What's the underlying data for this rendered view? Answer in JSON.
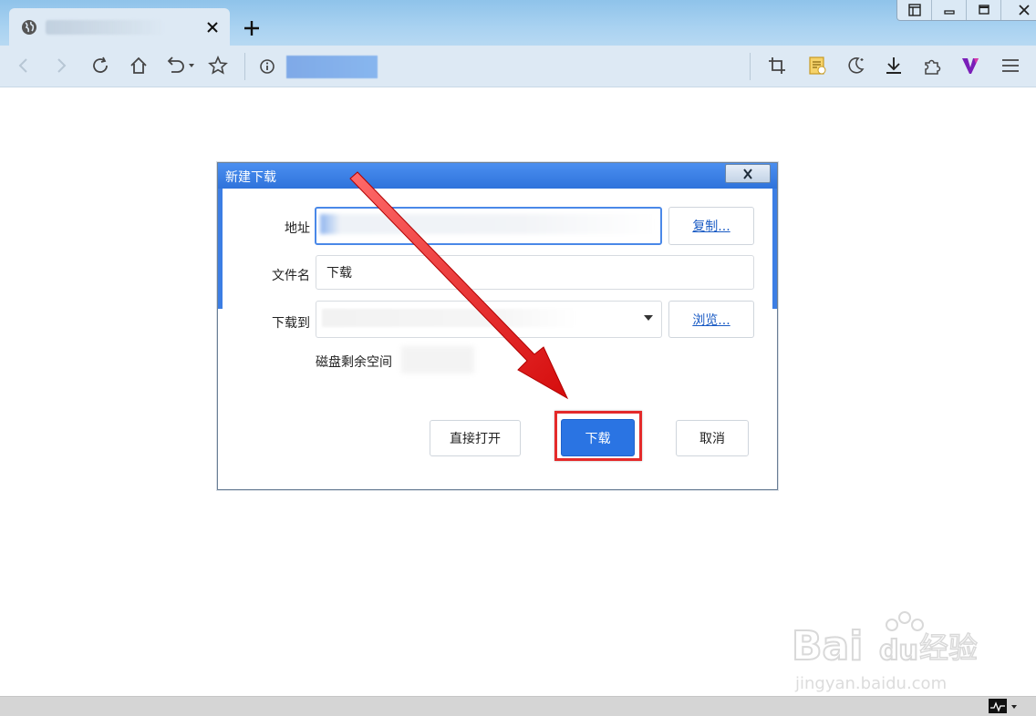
{
  "browser": {
    "tab": {
      "title": ""
    },
    "toolbar": {
      "address": ""
    },
    "window_controls": [
      "window-mode",
      "minimize",
      "maximize",
      "close"
    ]
  },
  "dialog": {
    "title": "新建下载",
    "url_label": "地址",
    "url_value": "",
    "copy_button": "复制...",
    "filename_label": "文件名",
    "filename_value": "下载",
    "save_to_label": "下载到",
    "save_to_value": "",
    "browse_button": "浏览...",
    "disk_space_label": "磁盘剩余空间",
    "open_button": "直接打开",
    "download_button": "下载",
    "cancel_button": "取消"
  },
  "annotation": {
    "highlight_color": "#e42a2a",
    "arrow_color": "#e31b1b"
  },
  "watermark": {
    "line1": "Bai du 经验",
    "line2": "jingyan.baidu.com"
  },
  "colors": {
    "accent": "#2a74e3",
    "titlebar": "#3c7ee4",
    "chrome": "#dde9f4"
  }
}
